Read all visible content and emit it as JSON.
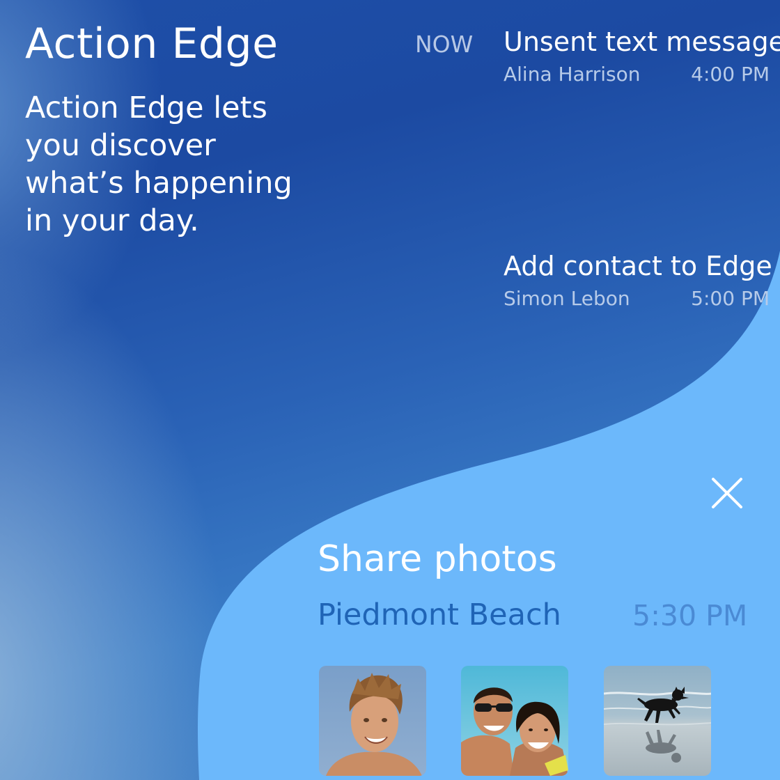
{
  "app": {
    "title": "Action Edge",
    "description": "Action Edge lets you discover what’s happening in your day."
  },
  "timeline": {
    "now_label": "NOW",
    "notifications": [
      {
        "title": "Unsent text message",
        "person": "Alina Harrison",
        "time": "4:00 PM"
      },
      {
        "title": "Add contact to Edge",
        "person": "Simon Lebon",
        "time": "5:00 PM"
      }
    ]
  },
  "share_card": {
    "title": "Share photos",
    "place": "Piedmont Beach",
    "time": "5:30 PM",
    "close_icon": "close-icon",
    "photos": [
      {
        "icon": "man-portrait-photo"
      },
      {
        "icon": "couple-selfie-photo"
      },
      {
        "icon": "dog-on-beach-photo"
      }
    ]
  },
  "colors": {
    "background_deep": "#1e4fa8",
    "card_light": "#6cb8fb",
    "place_text": "#1f64b6",
    "time_text": "#4a8ad4"
  }
}
